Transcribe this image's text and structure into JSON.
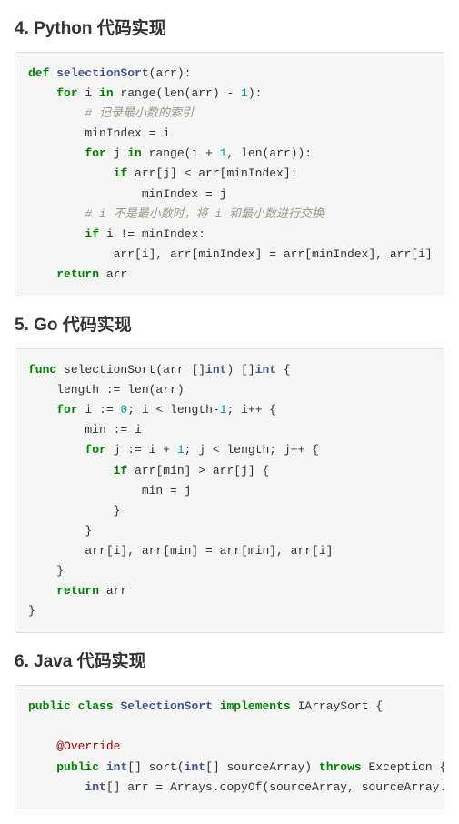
{
  "sections": {
    "python": {
      "heading": "4. Python 代码实现",
      "code": {
        "l1a": "def",
        "l1b": "selectionSort",
        "l1c": "(arr):",
        "l2a": "    ",
        "l2b": "for",
        "l2c": " i ",
        "l2d": "in",
        "l2e": " range(len(arr) - ",
        "l2f": "1",
        "l2g": "):",
        "l3a": "        ",
        "l3b": "# 记录最小数的索引",
        "l4": "        minIndex = i",
        "l5a": "        ",
        "l5b": "for",
        "l5c": " j ",
        "l5d": "in",
        "l5e": " range(i + ",
        "l5f": "1",
        "l5g": ", len(arr)):",
        "l6a": "            ",
        "l6b": "if",
        "l6c": " arr[j] < arr[minIndex]:",
        "l7": "                minIndex = j",
        "l8a": "        ",
        "l8b": "# i 不是最小数时，将 i 和最小数进行交换",
        "l9a": "        ",
        "l9b": "if",
        "l9c": " i != minIndex:",
        "l10": "            arr[i], arr[minIndex] = arr[minIndex], arr[i]",
        "l11a": "    ",
        "l11b": "return",
        "l11c": " arr"
      }
    },
    "go": {
      "heading": "5. Go 代码实现",
      "code": {
        "l1a": "func",
        "l1b": " selectionSort(arr []",
        "l1c": "int",
        "l1d": ") []",
        "l1e": "int",
        "l1f": " {",
        "l2": "    length := len(arr)",
        "l3a": "    ",
        "l3b": "for",
        "l3c": " i := ",
        "l3d": "0",
        "l3e": "; i < length-",
        "l3f": "1",
        "l3g": "; i++ {",
        "l4": "        min := i",
        "l5a": "        ",
        "l5b": "for",
        "l5c": " j := i + ",
        "l5d": "1",
        "l5e": "; j < length; j++ {",
        "l6a": "            ",
        "l6b": "if",
        "l6c": " arr[min] > arr[j] {",
        "l7": "                min = j",
        "l8": "            }",
        "l9": "        }",
        "l10": "        arr[i], arr[min] = arr[min], arr[i]",
        "l11": "    }",
        "l12a": "    ",
        "l12b": "return",
        "l12c": " arr",
        "l13": "}"
      }
    },
    "java": {
      "heading": "6. Java 代码实现",
      "code": {
        "l1a": "public",
        "l1b": " ",
        "l1c": "class",
        "l1d": " ",
        "l1e": "SelectionSort",
        "l1f": " ",
        "l1g": "implements",
        "l1h": " IArraySort {",
        "l2": "",
        "l3a": "    ",
        "l3b": "@Override",
        "l4a": "    ",
        "l4b": "public",
        "l4c": " ",
        "l4d": "int",
        "l4e": "[] sort(",
        "l4f": "int",
        "l4g": "[] sourceArray) ",
        "l4h": "throws",
        "l4i": " Exception {",
        "l5a": "        ",
        "l5b": "int",
        "l5c": "[] arr = Arrays.copyOf(sourceArray, sourceArray.length);"
      }
    }
  }
}
